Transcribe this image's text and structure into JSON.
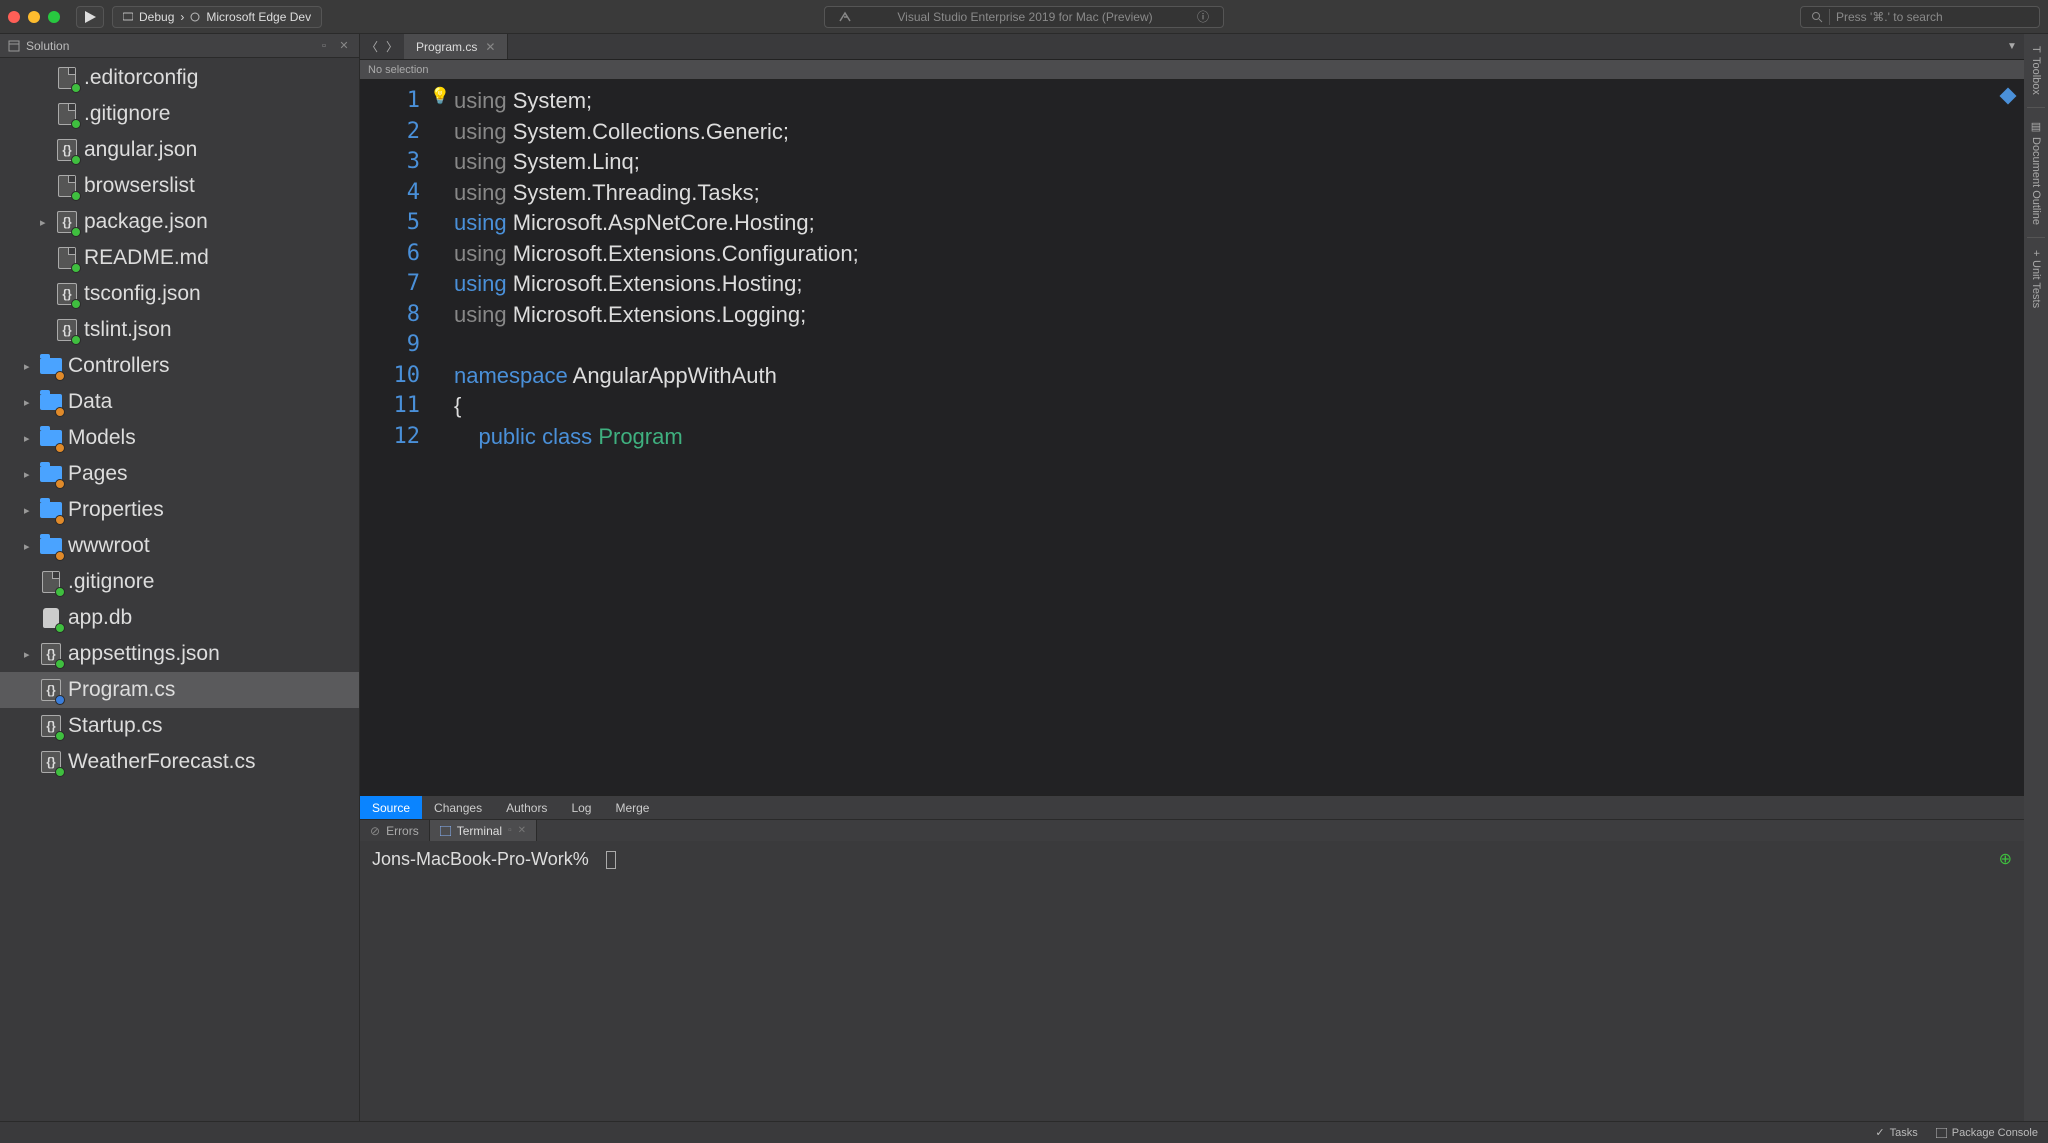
{
  "toolbar": {
    "run_config": "Debug",
    "config_sep": "›",
    "target": "Microsoft Edge Dev",
    "title": "Visual Studio Enterprise 2019 for Mac (Preview)",
    "search_placeholder": "Press '⌘.' to search"
  },
  "solution_panel": {
    "title": "Solution"
  },
  "tree": [
    {
      "name": ".editorconfig",
      "icon": "file",
      "badge": "green",
      "indent": 1
    },
    {
      "name": ".gitignore",
      "icon": "file",
      "badge": "green",
      "indent": 1
    },
    {
      "name": "angular.json",
      "icon": "json",
      "badge": "green",
      "indent": 1
    },
    {
      "name": "browserslist",
      "icon": "file",
      "badge": "green",
      "indent": 1
    },
    {
      "name": "package.json",
      "icon": "json",
      "badge": "green",
      "indent": 1,
      "expander": true
    },
    {
      "name": "README.md",
      "icon": "file",
      "badge": "green",
      "indent": 1
    },
    {
      "name": "tsconfig.json",
      "icon": "json",
      "badge": "green",
      "indent": 1
    },
    {
      "name": "tslint.json",
      "icon": "json",
      "badge": "green",
      "indent": 1
    },
    {
      "name": "Controllers",
      "icon": "folder",
      "badge": "orange",
      "indent": 0,
      "expander": true
    },
    {
      "name": "Data",
      "icon": "folder",
      "badge": "orange",
      "indent": 0,
      "expander": true
    },
    {
      "name": "Models",
      "icon": "folder",
      "badge": "orange",
      "indent": 0,
      "expander": true
    },
    {
      "name": "Pages",
      "icon": "folder",
      "badge": "orange",
      "indent": 0,
      "expander": true
    },
    {
      "name": "Properties",
      "icon": "folder",
      "badge": "orange",
      "indent": 0,
      "expander": true
    },
    {
      "name": "wwwroot",
      "icon": "folder",
      "badge": "orange",
      "indent": 0,
      "expander": true
    },
    {
      "name": ".gitignore",
      "icon": "file",
      "badge": "green",
      "indent": 0
    },
    {
      "name": "app.db",
      "icon": "db",
      "badge": "green",
      "indent": 0
    },
    {
      "name": "appsettings.json",
      "icon": "json",
      "badge": "green",
      "indent": 0,
      "expander": true
    },
    {
      "name": "Program.cs",
      "icon": "json",
      "badge": "blue",
      "indent": 0,
      "selected": true
    },
    {
      "name": "Startup.cs",
      "icon": "json",
      "badge": "green",
      "indent": 0
    },
    {
      "name": "WeatherForecast.cs",
      "icon": "json",
      "badge": "green",
      "indent": 0
    }
  ],
  "editor": {
    "tab_name": "Program.cs",
    "breadcrumb": "No selection",
    "lines": [
      [
        {
          "cls": "kw-using",
          "t": "using"
        },
        {
          "cls": "",
          "t": " System;"
        }
      ],
      [
        {
          "cls": "kw-using",
          "t": "using"
        },
        {
          "cls": "",
          "t": " System.Collections.Generic;"
        }
      ],
      [
        {
          "cls": "kw-using",
          "t": "using"
        },
        {
          "cls": "",
          "t": " System.Linq;"
        }
      ],
      [
        {
          "cls": "kw-using",
          "t": "using"
        },
        {
          "cls": "",
          "t": " System.Threading.Tasks;"
        }
      ],
      [
        {
          "cls": "kw-blue",
          "t": "using"
        },
        {
          "cls": "",
          "t": " Microsoft.AspNetCore.Hosting;"
        }
      ],
      [
        {
          "cls": "kw-using",
          "t": "using"
        },
        {
          "cls": "",
          "t": " Microsoft.Extensions.Configuration;"
        }
      ],
      [
        {
          "cls": "kw-blue",
          "t": "using"
        },
        {
          "cls": "",
          "t": " Microsoft.Extensions.Hosting;"
        }
      ],
      [
        {
          "cls": "kw-using",
          "t": "using"
        },
        {
          "cls": "",
          "t": " Microsoft.Extensions.Logging;"
        }
      ],
      [
        {
          "cls": "",
          "t": ""
        }
      ],
      [
        {
          "cls": "kw-blue",
          "t": "namespace"
        },
        {
          "cls": "",
          "t": " AngularAppWithAuth"
        }
      ],
      [
        {
          "cls": "",
          "t": "{"
        }
      ],
      [
        {
          "cls": "",
          "t": "    "
        },
        {
          "cls": "kw-blue",
          "t": "public"
        },
        {
          "cls": "",
          "t": " "
        },
        {
          "cls": "kw-blue",
          "t": "class"
        },
        {
          "cls": "",
          "t": " "
        },
        {
          "cls": "kw-green",
          "t": "Program"
        }
      ]
    ]
  },
  "sc_tabs": [
    "Source",
    "Changes",
    "Authors",
    "Log",
    "Merge"
  ],
  "bottom_tabs": {
    "errors": "Errors",
    "terminal": "Terminal"
  },
  "terminal": {
    "prompt": "Jons-MacBook-Pro-Work%"
  },
  "right_rail": {
    "toolbox": "Toolbox",
    "doc_outline": "Document Outline",
    "unit_tests": "Unit Tests"
  },
  "status": {
    "tasks": "Tasks",
    "pkg_console": "Package Console"
  }
}
